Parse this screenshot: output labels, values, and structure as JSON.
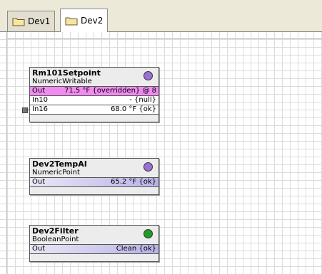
{
  "tabs": [
    {
      "label": "Dev1",
      "icon": "folder-icon",
      "active": false
    },
    {
      "label": "Dev2",
      "icon": "folder-icon",
      "active": true
    }
  ],
  "nodes": [
    {
      "title": "Rm101Setpoint",
      "type": "NumericWritable",
      "status_color": "#9b6fd6",
      "slots": [
        {
          "name": "Out",
          "value": "71.5 °F {overridden} @ 8",
          "style": "out-pink"
        },
        {
          "name": "In10",
          "value": "- {null}",
          "style": "plain"
        },
        {
          "name": "In16",
          "value": "68.0 °F {ok}",
          "style": "plain",
          "linked": true
        }
      ]
    },
    {
      "title": "Dev2TempAI",
      "type": "NumericPoint",
      "status_color": "#9b6fd6",
      "slots": [
        {
          "name": "Out",
          "value": "65.2 °F {ok}",
          "style": "out-blue"
        }
      ]
    },
    {
      "title": "Dev2Filter",
      "type": "BooleanPoint",
      "status_color": "#1f9e1f",
      "slots": [
        {
          "name": "Out",
          "value": "Clean {ok}",
          "style": "out-blue"
        }
      ]
    }
  ]
}
